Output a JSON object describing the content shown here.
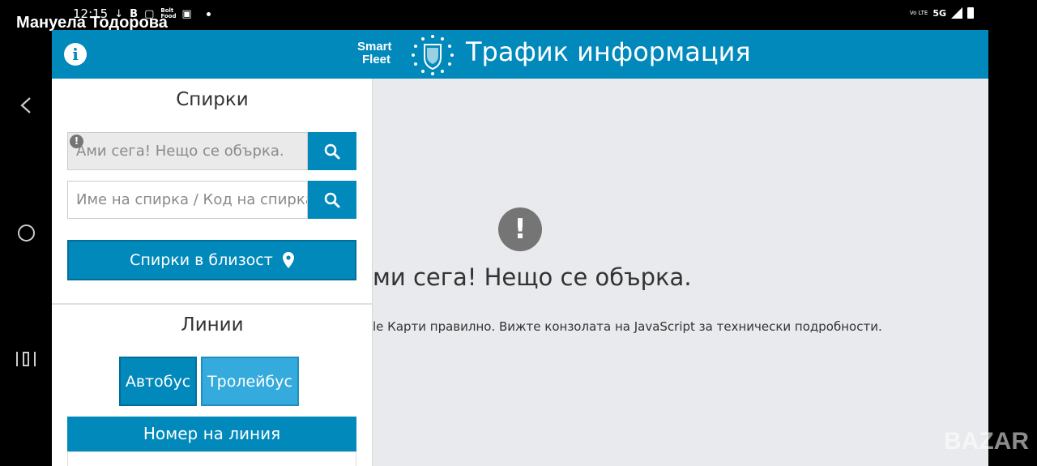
{
  "status_bar": {
    "time": "12:15",
    "notification_icons": [
      "download-arrow-icon",
      "b-app-icon",
      "square-icon",
      "bolt-food-icon",
      "emag-icon",
      "dot-icon"
    ],
    "bolt_label": "Bolt Food",
    "network": "5G",
    "volte": "Vo LTE"
  },
  "overlay_name": "Мануела Тодорова",
  "header": {
    "brand_line1": "Smart",
    "brand_line2": "Fleet",
    "title": "Трафик информация",
    "background_color": "#0189bc"
  },
  "stops": {
    "heading": "Спирки",
    "error_input_text": "Ами сега! Нещо се обърка.",
    "error_badge": "!",
    "stop_input_placeholder": "Име на спирка / Код на спирка",
    "nearby_button": "Спирки в близост"
  },
  "lines": {
    "heading": "Линии",
    "bus_button": "Автобус",
    "trolley_button": "Тролейбус",
    "line_number_header": "Номер на линия"
  },
  "map_error": {
    "badge": "!",
    "title": "ми сега! Нещо се обърка.",
    "description": "le Карти правилно. Вижте конзолата на JavaScript за технически подробности."
  },
  "watermark": "BAZAR"
}
